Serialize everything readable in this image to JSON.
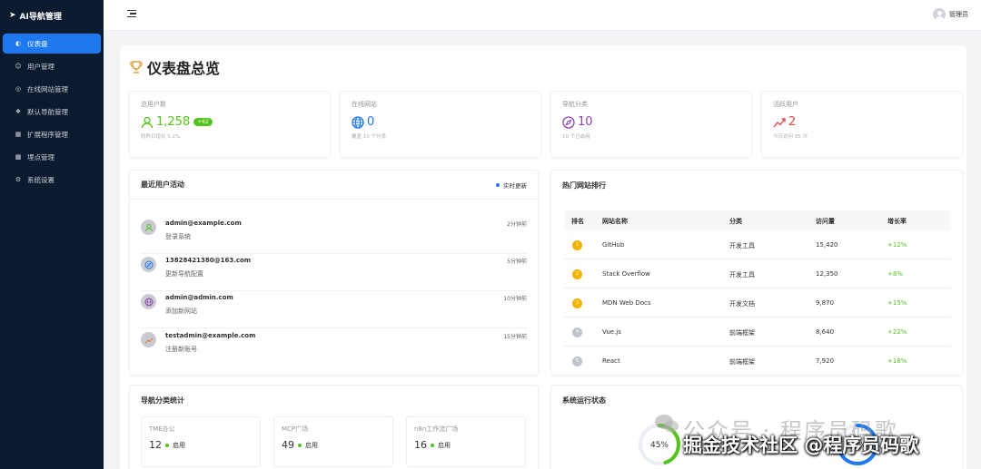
{
  "sidebar": {
    "logo": "AI导航管理",
    "items": [
      {
        "label": "仪表盘",
        "icon": "dashboard-icon",
        "active": true
      },
      {
        "label": "用户管理",
        "icon": "user-icon",
        "active": false
      },
      {
        "label": "在线网站管理",
        "icon": "globe-icon",
        "active": false
      },
      {
        "label": "默认导航管理",
        "icon": "compass-icon",
        "active": false
      },
      {
        "label": "扩展程序管理",
        "icon": "grid-icon",
        "active": false
      },
      {
        "label": "埋点管理",
        "icon": "chart-icon",
        "active": false
      },
      {
        "label": "系统设置",
        "icon": "gear-icon",
        "active": false
      }
    ]
  },
  "header": {
    "user": "管理员"
  },
  "page": {
    "title": "仪表盘总览"
  },
  "stats": [
    {
      "label": "总用户数",
      "value": "1,258",
      "badge": "+62",
      "sub": "较昨日增长 5.2%",
      "icon": "user-icon",
      "color": "#52c41a"
    },
    {
      "label": "在线网站",
      "value": "0",
      "sub": "覆盖 10 个分类",
      "icon": "globe-icon",
      "color": "#1e78f0"
    },
    {
      "label": "导航分类",
      "value": "10",
      "sub": "10 个已启用",
      "icon": "compass-icon",
      "color": "#8e44ad"
    },
    {
      "label": "活跃用户",
      "value": "2",
      "sub": "今日访问 35 次",
      "icon": "trend-icon",
      "color": "#e04848"
    }
  ],
  "activity": {
    "title": "最近用户活动",
    "realtime": "实时更新",
    "items": [
      {
        "user": "admin@example.com",
        "desc": "登录系统",
        "time": "2分钟前",
        "icon": "user-icon",
        "color": "#52c41a"
      },
      {
        "user": "13828421380@163.com",
        "desc": "更新导航配置",
        "time": "5分钟前",
        "icon": "compass-icon",
        "color": "#1e78f0"
      },
      {
        "user": "admin@admin.com",
        "desc": "添加新网站",
        "time": "10分钟前",
        "icon": "globe-icon",
        "color": "#8e44ad"
      },
      {
        "user": "testadmin@example.com",
        "desc": "注册新账号",
        "time": "15分钟前",
        "icon": "trend-icon",
        "color": "#e07b39"
      }
    ]
  },
  "ranking": {
    "title": "热门网站排行",
    "headers": [
      "排名",
      "网站名称",
      "分类",
      "访问量",
      "增长率"
    ],
    "rows": [
      {
        "rank": "1",
        "name": "GitHub",
        "category": "开发工具",
        "visits": "15,420",
        "growth": "+12%",
        "color": "#f0b400"
      },
      {
        "rank": "2",
        "name": "Stack Overflow",
        "category": "开发工具",
        "visits": "12,350",
        "growth": "+8%",
        "color": "#f0b400"
      },
      {
        "rank": "3",
        "name": "MDN Web Docs",
        "category": "开发文档",
        "visits": "9,870",
        "growth": "+15%",
        "color": "#f0b400"
      },
      {
        "rank": "4",
        "name": "Vue.js",
        "category": "前端框架",
        "visits": "8,640",
        "growth": "+22%",
        "color": "#c0c4cc"
      },
      {
        "rank": "5",
        "name": "React",
        "category": "前端框架",
        "visits": "7,920",
        "growth": "+18%",
        "color": "#c0c4cc"
      }
    ]
  },
  "nav_stats": {
    "title": "导航分类统计",
    "items": [
      {
        "name": "TME办公",
        "count": "12",
        "status": "启用"
      },
      {
        "name": "MCP广场",
        "count": "49",
        "status": "启用"
      },
      {
        "name": "n8n工作流广场",
        "count": "16",
        "status": "启用"
      }
    ]
  },
  "system": {
    "title": "系统运行状态",
    "gauges": [
      {
        "value": 45,
        "label": "45%",
        "color": "#52c41a"
      },
      {
        "value": 68,
        "label": "68%",
        "color": "#1e78f0"
      }
    ]
  },
  "watermark": {
    "line1": "公众号 · 程序员码歌",
    "line2": "掘金技术社区 @程序员码歌"
  }
}
